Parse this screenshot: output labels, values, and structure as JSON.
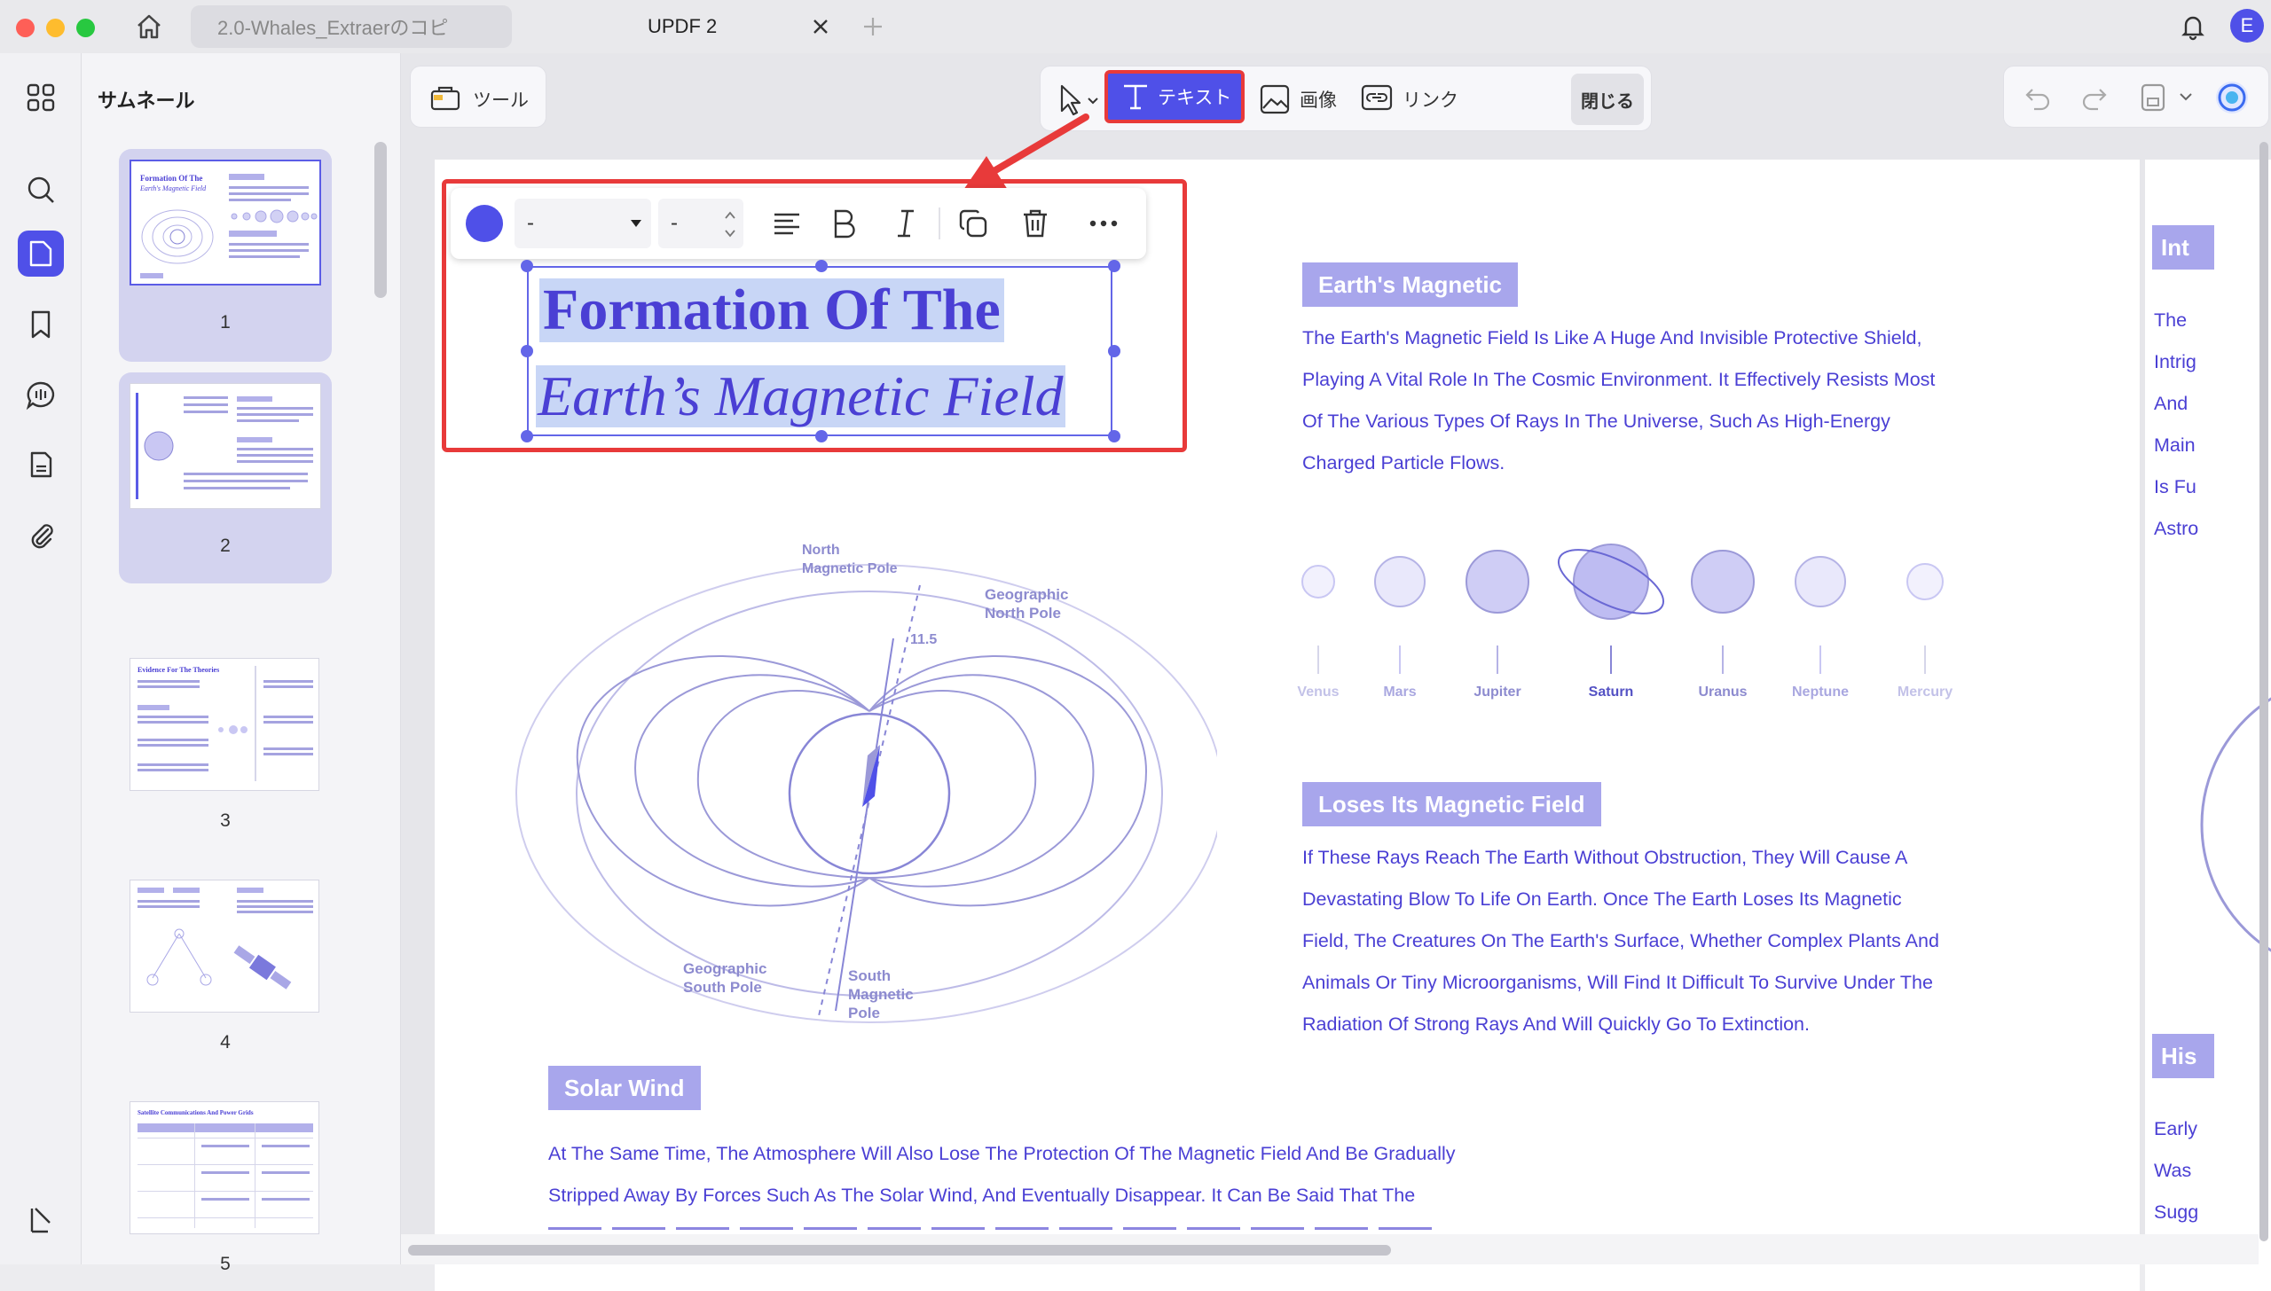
{
  "window": {
    "tabs": [
      {
        "label": "2.0-Whales_Extraerのコピ"
      },
      {
        "label": "UPDF 2"
      }
    ],
    "avatar_letter": "E"
  },
  "sidebar": {
    "panel_title": "サムネール",
    "thumbnails": [
      {
        "page": "1",
        "mini_title_line1": "Formation Of The",
        "mini_title_line2": "Earth's Magnetic Field"
      },
      {
        "page": "2"
      },
      {
        "page": "3",
        "mini_title": "Evidence For The Theories"
      },
      {
        "page": "4"
      },
      {
        "page": "5",
        "mini_title": "Satellite Communications And Power Grids"
      }
    ]
  },
  "toolbar": {
    "tools_label": "ツール",
    "text_label": "テキスト",
    "image_label": "画像",
    "link_label": "リンク",
    "close_label": "閉じる"
  },
  "format_toolbar": {
    "color": "#4f50e8",
    "font_value": "-",
    "size_value": "-"
  },
  "document": {
    "title_line1": "Formation Of The",
    "title_line2": "Earth’s Magnetic Field",
    "diagram_labels": {
      "north_magnetic_pole_1": "North",
      "north_magnetic_pole_2": "Magnetic Pole",
      "geographic_north_1": "Geographic",
      "geographic_north_2": "North Pole",
      "angle": "11.5",
      "geographic_south_1": "Geographic",
      "geographic_south_2": "South Pole",
      "south_magnetic_1": "South",
      "south_magnetic_2": "Magnetic",
      "south_magnetic_3": "Pole"
    },
    "section1": {
      "heading": "Earth's Magnetic",
      "text": "The Earth's Magnetic Field Is Like A Huge And Invisible Protective Shield,\nPlaying A Vital Role In The Cosmic Environment. It Effectively Resists Most\nOf The Various Types Of Rays In The Universe, Such As High-Energy\nCharged Particle Flows."
    },
    "planets": [
      {
        "name": "Venus"
      },
      {
        "name": "Mars"
      },
      {
        "name": "Jupiter"
      },
      {
        "name": "Saturn"
      },
      {
        "name": "Uranus"
      },
      {
        "name": "Neptune"
      },
      {
        "name": "Mercury"
      }
    ],
    "section2": {
      "heading": "Loses Its Magnetic Field",
      "text": "If These Rays Reach The Earth Without Obstruction, They Will Cause A\nDevastating Blow To Life On Earth. Once The Earth Loses Its Magnetic\nField, The Creatures On The Earth's Surface, Whether Complex Plants And\nAnimals Or Tiny Microorganisms, Will Find It Difficult To Survive Under The\nRadiation Of Strong Rays And Will Quickly Go To Extinction."
    },
    "section3": {
      "heading": "Solar Wind",
      "text": "At The Same Time, The Atmosphere Will Also Lose The Protection Of The Magnetic Field And Be Gradually\nStripped Away By Forces Such As The Solar Wind, And Eventually Disappear. It Can Be Said That The"
    },
    "next_page": {
      "heading": "Int",
      "lines": [
        "The",
        "Intrig",
        "And",
        "Main",
        "Is Fu",
        "Astro"
      ],
      "heading2": "His",
      "lines2": [
        "Early",
        "Was",
        "Sugg"
      ]
    }
  },
  "colors": {
    "accent": "#4f50e8",
    "highlight_red": "#e83a3a",
    "doc_text": "#4a3fd4",
    "tag_bg": "#a8a6ec"
  }
}
